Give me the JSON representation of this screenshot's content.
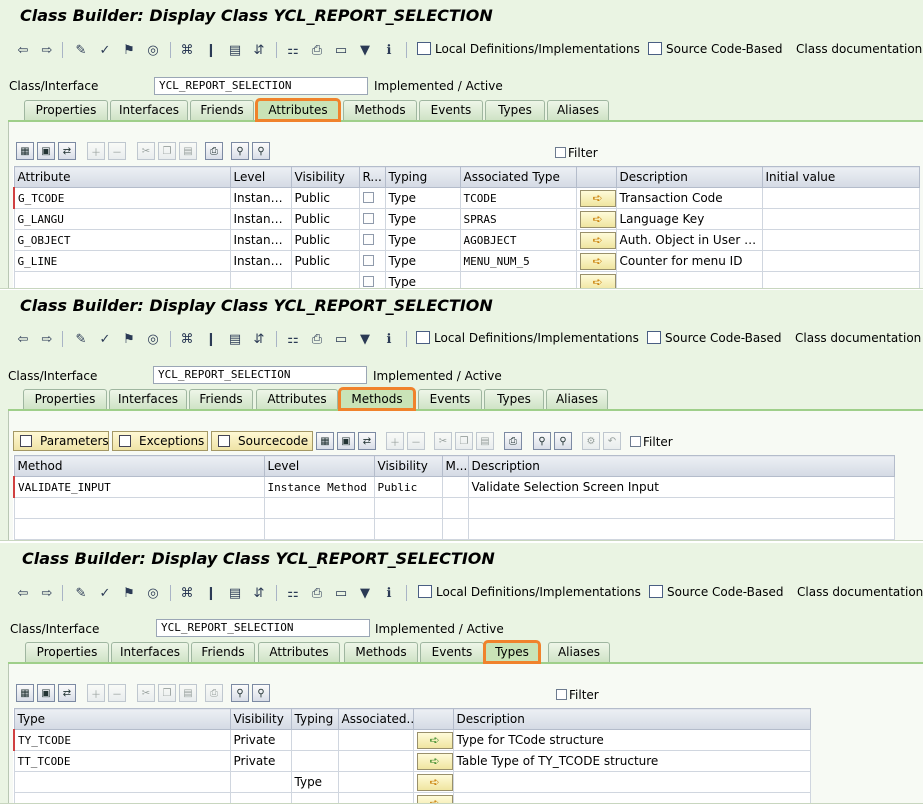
{
  "toolbar": {
    "local_defs_label": "Local Definitions/Implementations",
    "source_code_label": "Source Code-Based",
    "class_doc_label": "Class documentation"
  },
  "class_interface": {
    "label": "Class/Interface",
    "value": "YCL_REPORT_SELECTION",
    "status": "Implemented / Active"
  },
  "tabs": [
    "Properties",
    "Interfaces",
    "Friends",
    "Attributes",
    "Methods",
    "Events",
    "Types",
    "Aliases"
  ],
  "panels": [
    {
      "title": "Class Builder: Display Class YCL_REPORT_SELECTION",
      "active_tab": "Attributes",
      "filter_label": "Filter",
      "columns": [
        "Attribute",
        "Level",
        "Visibility",
        "R...",
        "Typing",
        "Associated Type",
        "",
        "Description",
        "Initial value"
      ],
      "rows": [
        {
          "attribute": "G_TCODE",
          "level": "Instance ...",
          "visibility": "Public",
          "typing": "Type",
          "assoc": "TCODE",
          "description": "Transaction Code"
        },
        {
          "attribute": "G_LANGU",
          "level": "Instance ...",
          "visibility": "Public",
          "typing": "Type",
          "assoc": "SPRAS",
          "description": "Language Key"
        },
        {
          "attribute": "G_OBJECT",
          "level": "Instance ...",
          "visibility": "Public",
          "typing": "Type",
          "assoc": "AGOBJECT",
          "description": "Auth. Object in User Mas..."
        },
        {
          "attribute": "G_LINE",
          "level": "Instance ...",
          "visibility": "Public",
          "typing": "Type",
          "assoc": "MENU_NUM_5",
          "description": "Counter for menu ID"
        },
        {
          "attribute": "",
          "level": "",
          "visibility": "",
          "typing": "Type",
          "assoc": "",
          "description": ""
        }
      ]
    },
    {
      "title": "Class Builder: Display Class YCL_REPORT_SELECTION",
      "active_tab": "Methods",
      "buttons": {
        "parameters": "Parameters",
        "exceptions": "Exceptions",
        "sourcecode": "Sourcecode"
      },
      "filter_label": "Filter",
      "columns": [
        "Method",
        "Level",
        "Visibility",
        "M...",
        "Description"
      ],
      "rows": [
        {
          "method": "VALIDATE_INPUT",
          "level": "Instance Method",
          "visibility": "Public",
          "m": "",
          "description": "Validate Selection Screen Input"
        }
      ]
    },
    {
      "title": "Class Builder: Display Class YCL_REPORT_SELECTION",
      "active_tab": "Types",
      "filter_label": "Filter",
      "columns": [
        "Type",
        "Visibility",
        "Typing",
        "Associated...",
        "",
        "Description"
      ],
      "rows": [
        {
          "type": "TY_TCODE",
          "visibility": "Private",
          "typing": "",
          "assoc": "",
          "description": "Type for TCode structure"
        },
        {
          "type": "TT_TCODE",
          "visibility": "Private",
          "typing": "",
          "assoc": "",
          "description": "Table Type of TY_TCODE structure"
        },
        {
          "type": "",
          "visibility": "",
          "typing": "Type",
          "assoc": "",
          "description": ""
        }
      ]
    }
  ]
}
